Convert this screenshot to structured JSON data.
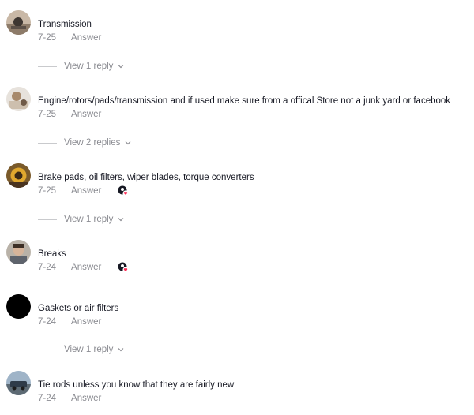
{
  "comments": [
    {
      "text": "Transmission",
      "date": "7-25",
      "answer_label": "Answer",
      "replies_label": "View 1 reply",
      "creator_liked": false
    },
    {
      "text": "Engine/rotors/pads/transmission and if used make sure from a offical Store not a junk yard or facebook",
      "date": "7-25",
      "answer_label": "Answer",
      "replies_label": "View 2 replies",
      "creator_liked": false
    },
    {
      "text": "Brake pads, oil filters, wiper blades, torque converters",
      "date": "7-25",
      "answer_label": "Answer",
      "replies_label": "View 1 reply",
      "creator_liked": true
    },
    {
      "text": "Breaks",
      "date": "7-24",
      "answer_label": "Answer",
      "creator_liked": true
    },
    {
      "text": "Gaskets or air filters",
      "date": "7-24",
      "answer_label": "Answer",
      "replies_label": "View 1 reply",
      "creator_liked": false
    },
    {
      "text": "Tie rods unless you know that they are fairly new",
      "date": "7-24",
      "answer_label": "Answer",
      "creator_liked": false
    }
  ],
  "icons": {
    "avatar": "user-avatar-icon",
    "chevron": "chevron-down-icon",
    "creator_badge": "creator-liked-icon"
  },
  "colors": {
    "text": "#161823",
    "muted": "#8a8b91",
    "heart": "#fe2c55"
  }
}
